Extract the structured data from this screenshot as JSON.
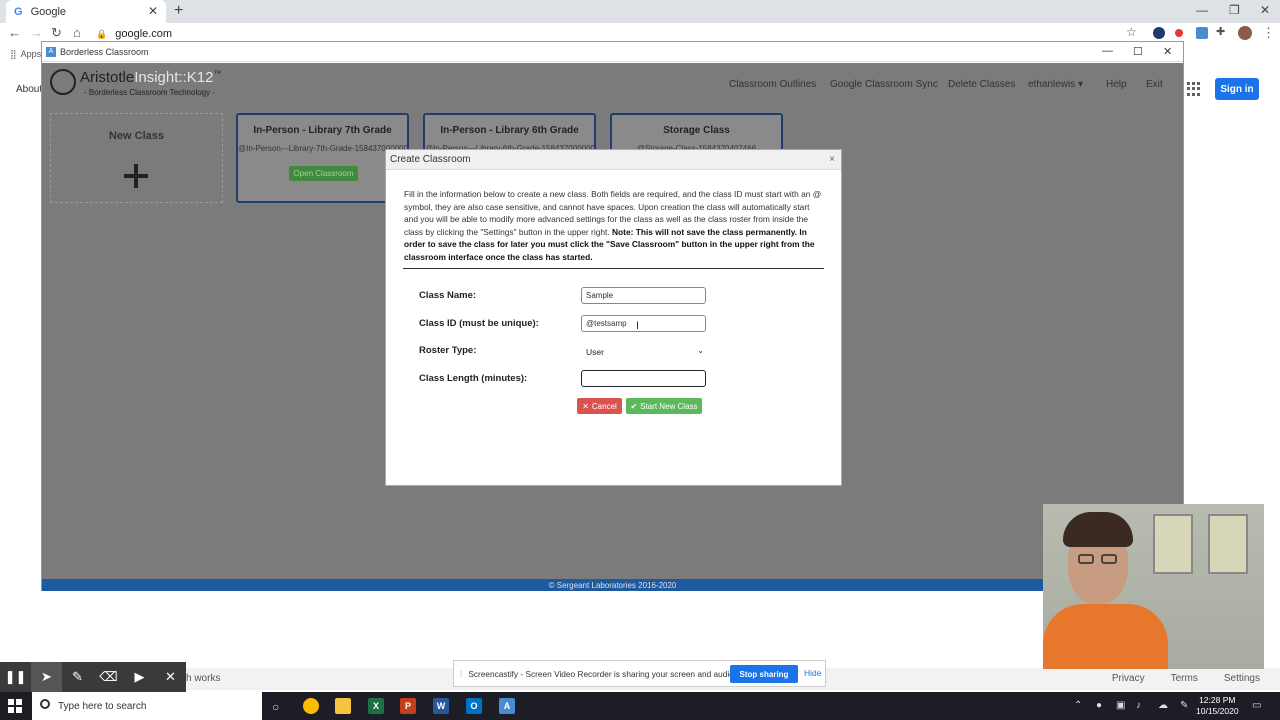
{
  "browser": {
    "tab_title": "Google",
    "url": "google.com",
    "bookmarks_label": "Apps"
  },
  "google_page": {
    "about": "About",
    "sign_in": "Sign in",
    "footer_left": "h works",
    "footer_links": [
      "Privacy",
      "Terms",
      "Settings"
    ]
  },
  "app_window": {
    "title": "Borderless Classroom",
    "logo_main_a": "Aristotle",
    "logo_main_b": "Insight::K12",
    "logo_tm": "™",
    "logo_sub": "- Borderless Classroom Technology -",
    "nav": [
      "Classroom Outlines",
      "Google Classroom Sync",
      "Delete Classes",
      "ethanlewis ▾",
      "Help",
      "Exit"
    ],
    "footer": "© Sergeant Laboratories 2016-2020"
  },
  "cards": {
    "new_class": "New Class",
    "classes": [
      {
        "title": "In-Person - Library 7th Grade",
        "id": "@In-Person---Library-7th-Grade-1584370000000",
        "open": "Open Classroom"
      },
      {
        "title": "In-Person - Library 6th Grade",
        "id": "@In-Person---Library-6th-Grade-1584370000000",
        "open": "Open Classroom"
      },
      {
        "title": "Storage Class",
        "id": "@Storage-Class-1584370407466",
        "open": "Open Classroom"
      }
    ]
  },
  "modal": {
    "title": "Create Classroom",
    "close": "×",
    "desc_plain": "Fill in the information below to create a new class. Both fields are required, and the class ID must start with an @ symbol, they are also case sensitive, and cannot have spaces. Upon creation the class will automatically start and you will be able to modify more advanced settings for the class as well as the class roster from inside the class by clicking the \"Settings\" button in the upper right. ",
    "desc_bold": "Note: This will not save the class permanently. In order to save the class for later you must click the \"Save Classroom\" button in the upper right from the classroom interface once the class has started.",
    "class_name_label": "Class Name:",
    "class_name_value": "Sample",
    "class_id_label": "Class ID (must be unique):",
    "class_id_value": "@testsamp",
    "roster_label": "Roster Type:",
    "roster_value": "User",
    "length_label": "Class Length (minutes):",
    "length_value": "",
    "cancel": "Cancel",
    "start": "Start New Class"
  },
  "screencastify": {
    "message": "Screencastify - Screen Video Recorder is sharing your screen and audio.",
    "stop": "Stop sharing",
    "hide": "Hide"
  },
  "taskbar": {
    "search_placeholder": "Type here to search",
    "time": "12:28 PM",
    "date": "10/15/2020"
  },
  "colors": {
    "app_header": "#7b7b7b",
    "footer_blue": "#1e5aa0",
    "google_blue": "#1a73e8",
    "cancel_red": "#d9534f",
    "start_green": "#5cb85c"
  }
}
